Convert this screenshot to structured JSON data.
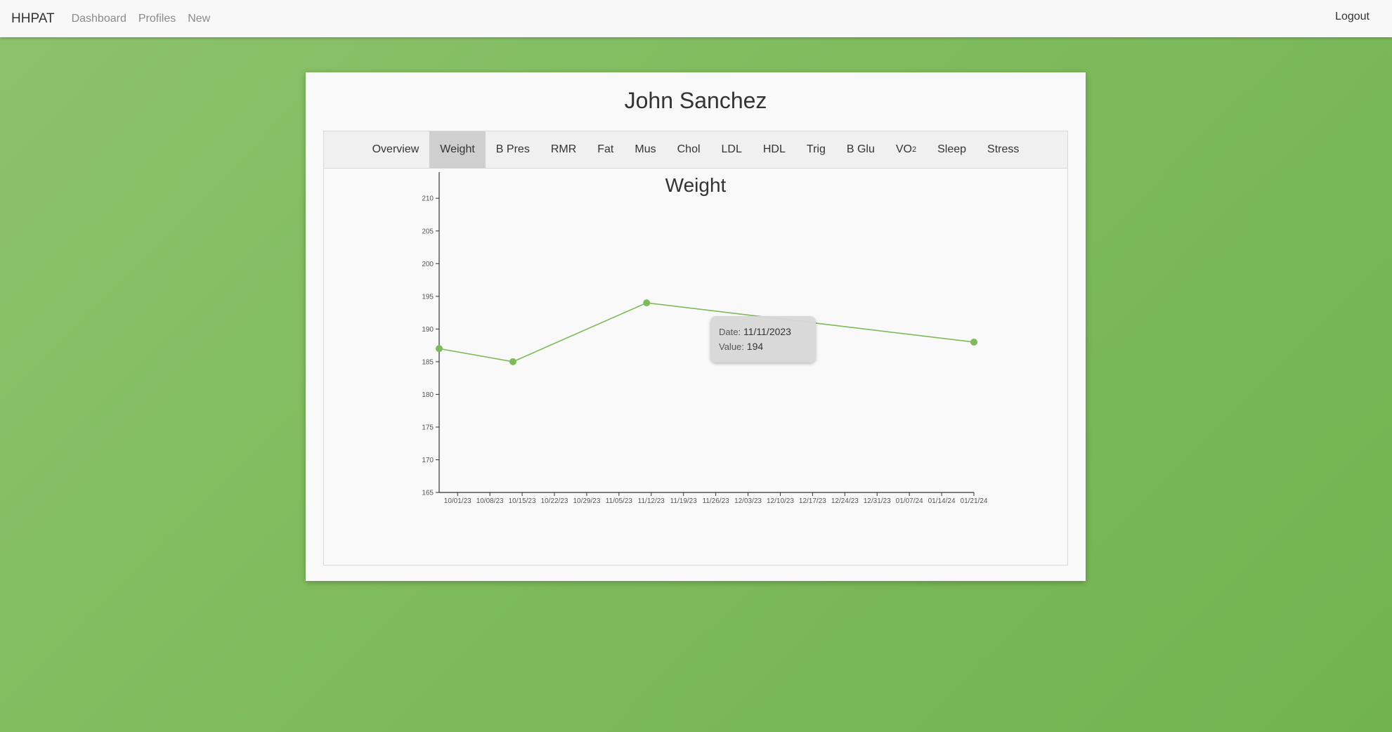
{
  "nav": {
    "brand": "HHPAT",
    "links": [
      "Dashboard",
      "Profiles",
      "New"
    ],
    "logout": "Logout"
  },
  "profile": {
    "name": "John Sanchez"
  },
  "tabs": [
    {
      "label": "Overview",
      "sub": ""
    },
    {
      "label": "Weight",
      "sub": "",
      "active": true
    },
    {
      "label": "B Pres",
      "sub": ""
    },
    {
      "label": "RMR",
      "sub": ""
    },
    {
      "label": "Fat",
      "sub": ""
    },
    {
      "label": "Mus",
      "sub": ""
    },
    {
      "label": "Chol",
      "sub": ""
    },
    {
      "label": "LDL",
      "sub": ""
    },
    {
      "label": "HDL",
      "sub": ""
    },
    {
      "label": "Trig",
      "sub": ""
    },
    {
      "label": "B Glu",
      "sub": ""
    },
    {
      "label": "VO",
      "sub": "2"
    },
    {
      "label": "Sleep",
      "sub": ""
    },
    {
      "label": "Stress",
      "sub": ""
    }
  ],
  "colors": {
    "accent": "#7dbb5a",
    "line": "#7dbb5a"
  },
  "tooltip": {
    "date_label": "Date:",
    "date_value": "11/11/2023",
    "value_label": "Value:",
    "value_value": "194"
  },
  "chart_data": {
    "type": "line",
    "title": "Weight",
    "xlabel": "",
    "ylabel": "",
    "ylim": [
      165,
      214
    ],
    "x_tick_labels": [
      "10/01/23",
      "10/08/23",
      "10/15/23",
      "10/22/23",
      "10/29/23",
      "11/05/23",
      "11/12/23",
      "11/19/23",
      "11/26/23",
      "12/03/23",
      "12/10/23",
      "12/17/23",
      "12/24/23",
      "12/31/23",
      "01/07/24",
      "01/14/24",
      "01/21/24"
    ],
    "y_ticks": [
      165,
      170,
      175,
      180,
      185,
      190,
      195,
      200,
      205,
      210
    ],
    "xlim": [
      "2023-09-27",
      "2024-01-21"
    ],
    "points": [
      {
        "x": "2023-09-27",
        "y": 187
      },
      {
        "x": "2023-10-13",
        "y": 185
      },
      {
        "x": "2023-11-11",
        "y": 194
      },
      {
        "x": "2024-01-21",
        "y": 188
      }
    ],
    "grid": false,
    "legend": "none"
  }
}
